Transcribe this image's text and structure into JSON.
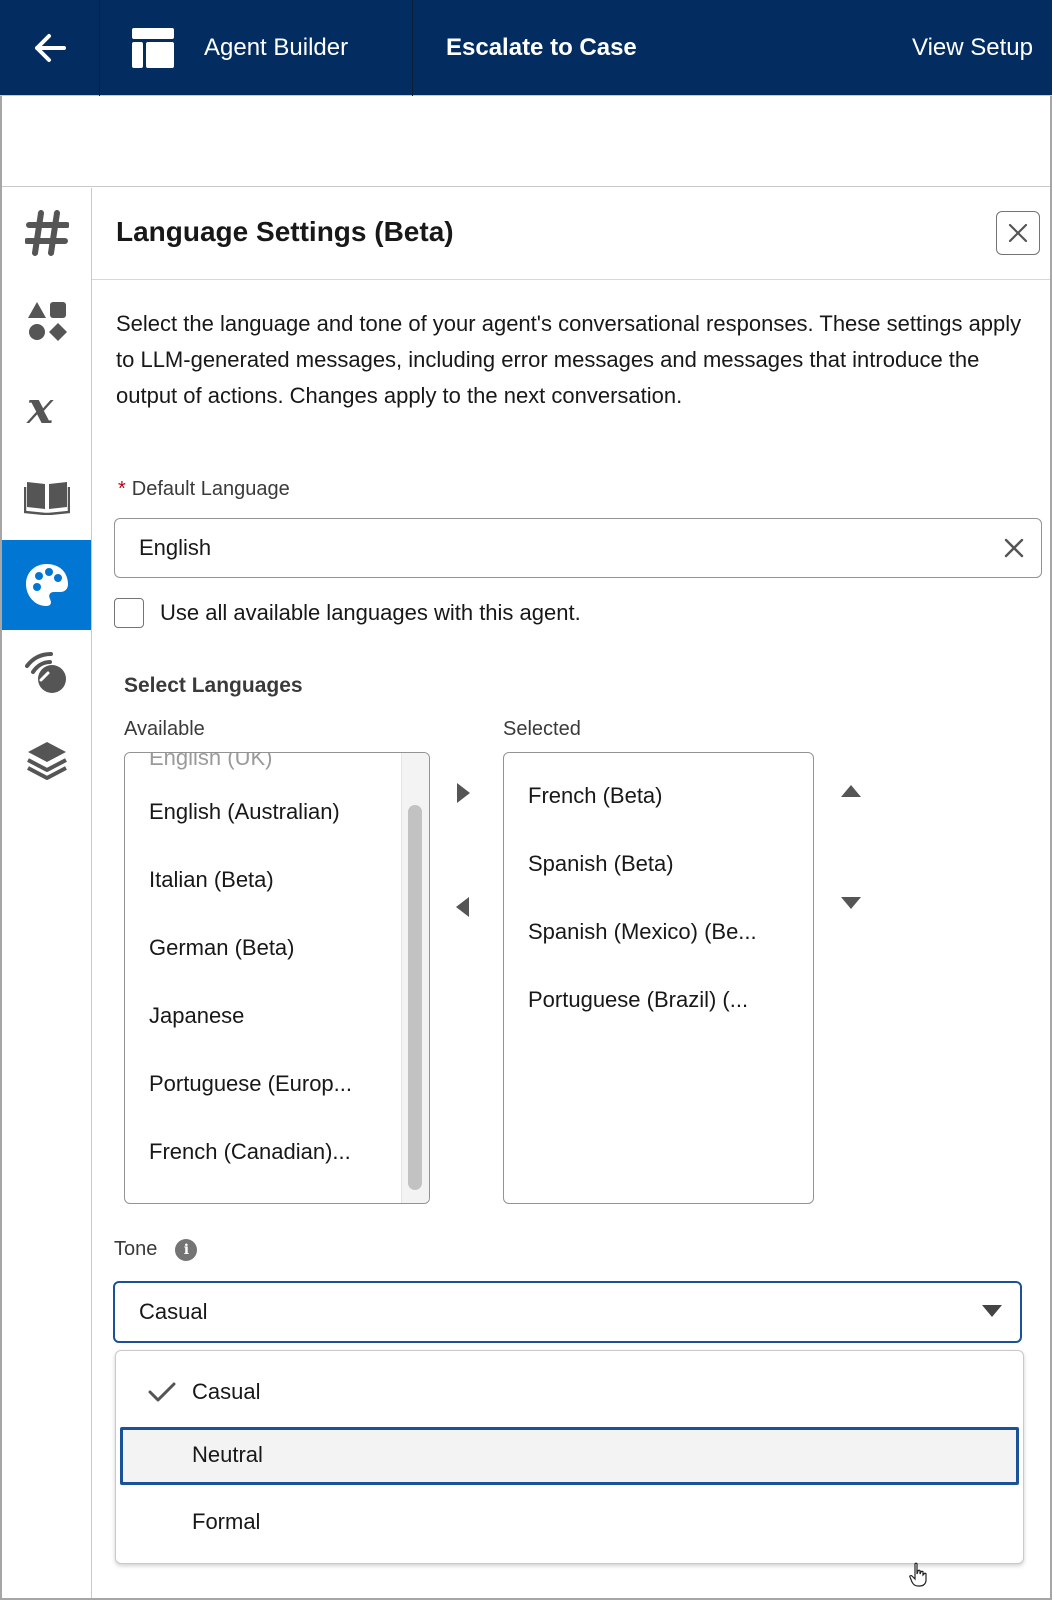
{
  "header": {
    "back_icon": "arrow-left-icon",
    "app_icon": "app-layout-icon",
    "app_name": "Agent Builder",
    "record_title": "Escalate to Case",
    "view_setup": "View Setup",
    "colors": {
      "bar": "#032d60",
      "text": "#ffffff"
    }
  },
  "rail": {
    "items": [
      {
        "icon": "hash-icon"
      },
      {
        "icon": "shapes-icon"
      },
      {
        "icon": "variable-icon"
      },
      {
        "icon": "book-icon"
      },
      {
        "icon": "palette-icon",
        "active": true
      },
      {
        "icon": "signal-icon"
      },
      {
        "icon": "layers-icon"
      }
    ],
    "active_color": "#0176d3"
  },
  "panel": {
    "title": "Language Settings (Beta)",
    "description": "Select the language and tone of your agent's conversational responses. These settings apply to LLM-generated messages, including error messages and messages that introduce the output of actions. Changes apply to the next conversation.",
    "default_language": {
      "required_marker": "*",
      "label": "Default Language",
      "value": "English"
    },
    "use_all_checkbox": {
      "label": "Use all available languages with this agent.",
      "checked": false
    },
    "select_languages": {
      "title": "Select Languages",
      "available_label": "Available",
      "selected_label": "Selected",
      "available": [
        "English (Australian)",
        "Italian (Beta)",
        "German (Beta)",
        "Japanese",
        "Portuguese (Europ...",
        "French (Canadian)..."
      ],
      "selected": [
        "French (Beta)",
        "Spanish (Beta)",
        "Spanish (Mexico) (Be...",
        "Portuguese (Brazil) (..."
      ]
    },
    "tone": {
      "label": "Tone",
      "value": "Casual",
      "options": [
        {
          "label": "Casual",
          "checked": true
        },
        {
          "label": "Neutral",
          "hovered": true
        },
        {
          "label": "Formal"
        }
      ]
    }
  }
}
